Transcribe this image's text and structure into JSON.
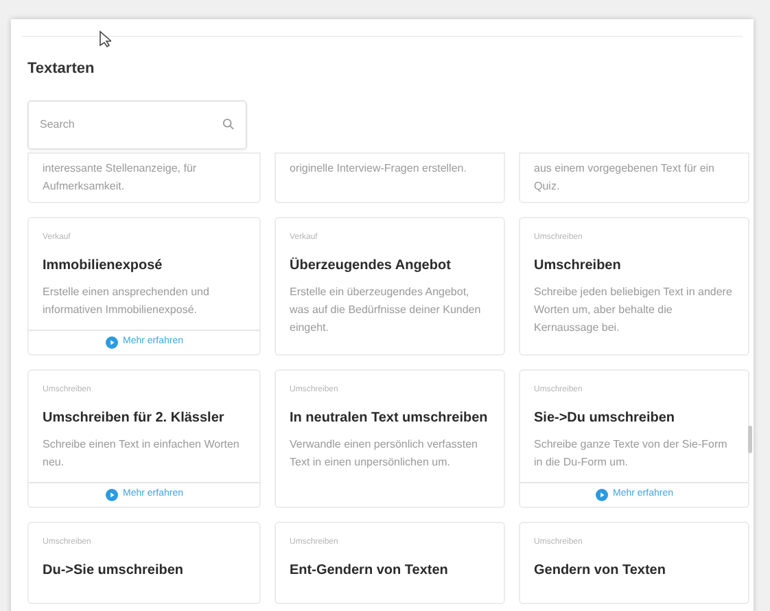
{
  "title": "Textarten",
  "search": {
    "placeholder": "Search"
  },
  "cards": [
    {
      "kind": "cut_top",
      "description": "interessante Stellenanzeige, für Aufmerksamkeit."
    },
    {
      "kind": "cut_top",
      "description": "originelle Interview-Fragen erstellen."
    },
    {
      "kind": "cut_top",
      "description": "aus einem vorgegebenen Text für ein Quiz."
    },
    {
      "kind": "full",
      "category": "Verkauf",
      "title": "Immobilienexposé",
      "description": "Erstelle einen ansprechenden und informativen Immobilienexposé.",
      "more": true,
      "more_label": "Mehr erfahren"
    },
    {
      "kind": "full",
      "category": "Verkauf",
      "title": "Überzeugendes Angebot",
      "description": "Erstelle ein überzeugendes Angebot, was auf die Bedürfnisse deiner Kunden eingeht.",
      "more": false
    },
    {
      "kind": "full",
      "category": "Umschreiben",
      "title": "Umschreiben",
      "description": "Schreibe jeden beliebigen Text in andere Worten um, aber behalte die Kernaussage bei.",
      "more": false
    },
    {
      "kind": "full",
      "category": "Umschreiben",
      "title": "Umschreiben für 2. Klässler",
      "description": "Schreibe einen Text in einfachen Worten neu.",
      "more": true,
      "more_label": "Mehr erfahren"
    },
    {
      "kind": "full",
      "category": "Umschreiben",
      "title": "In neutralen Text umschreiben",
      "description": "Verwandle einen persönlich verfassten Text in einen unpersönlichen um.",
      "more": false
    },
    {
      "kind": "full",
      "category": "Umschreiben",
      "title": "Sie->Du umschreiben",
      "description": "Schreibe ganze Texte von der Sie-Form in die Du-Form um.",
      "more": true,
      "more_label": "Mehr erfahren"
    },
    {
      "kind": "cut_bottom",
      "category": "Umschreiben",
      "title": "Du->Sie umschreiben"
    },
    {
      "kind": "cut_bottom",
      "category": "Umschreiben",
      "title": "Ent-Gendern von Texten"
    },
    {
      "kind": "cut_bottom",
      "category": "Umschreiben",
      "title": "Gendern von Texten"
    }
  ]
}
